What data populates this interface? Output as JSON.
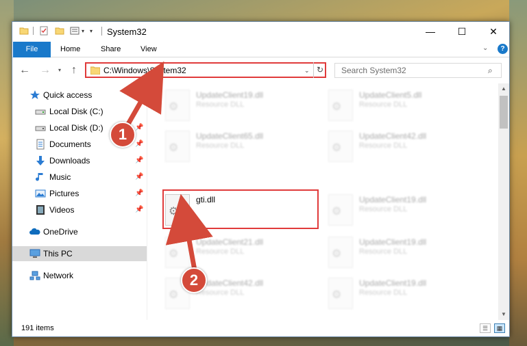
{
  "window": {
    "title": "System32",
    "controls": {
      "minimize": "—",
      "maximize": "☐",
      "close": "✕"
    }
  },
  "ribbon": {
    "tabs": [
      "File",
      "Home",
      "Share",
      "View"
    ],
    "help": "?"
  },
  "address_bar": {
    "path": "C:\\Windows\\System32",
    "search_placeholder": "Search System32"
  },
  "nav_pane": {
    "items": [
      {
        "label": "Quick access",
        "icon": "star-icon",
        "pinned": false
      },
      {
        "label": "Local Disk (C:)",
        "icon": "drive-icon",
        "pinned": false
      },
      {
        "label": "Local Disk (D:)",
        "icon": "drive-icon",
        "pinned": true
      },
      {
        "label": "Documents",
        "icon": "document-icon",
        "pinned": true
      },
      {
        "label": "Downloads",
        "icon": "download-icon",
        "pinned": true
      },
      {
        "label": "Music",
        "icon": "music-icon",
        "pinned": true
      },
      {
        "label": "Pictures",
        "icon": "pictures-icon",
        "pinned": true
      },
      {
        "label": "Videos",
        "icon": "videos-icon",
        "pinned": true
      },
      {
        "label": "OneDrive",
        "icon": "cloud-icon",
        "pinned": false
      },
      {
        "label": "This PC",
        "icon": "computer-icon",
        "pinned": false,
        "selected": true
      },
      {
        "label": "Network",
        "icon": "network-icon",
        "pinned": false
      }
    ]
  },
  "files": [
    {
      "name": "UpdateClient19.dll",
      "type": "Resource DLL",
      "blurred": true
    },
    {
      "name": "UpdateClient5.dll",
      "type": "Resource DLL",
      "blurred": true
    },
    {
      "name": "UpdateClient65.dll",
      "type": "Resource DLL",
      "blurred": true
    },
    {
      "name": "UpdateClient42.dll",
      "type": "Resource DLL",
      "blurred": true
    },
    {
      "name": "gti.dll",
      "type": "",
      "blurred": false,
      "highlighted": true
    },
    {
      "name": "UpdateClient19.dll",
      "type": "Resource DLL",
      "blurred": true
    },
    {
      "name": "UpdateClient21.dll",
      "type": "Resource DLL",
      "blurred": true
    },
    {
      "name": "UpdateClient19.dll",
      "type": "Resource DLL",
      "blurred": true
    },
    {
      "name": "UpdateClient42.dll",
      "type": "Resource DLL",
      "blurred": true
    },
    {
      "name": "UpdateClient19.dll",
      "type": "Resource DLL",
      "blurred": true
    }
  ],
  "status_bar": {
    "item_count": "191 items"
  },
  "annotations": {
    "badge_1": "1",
    "badge_2": "2",
    "color": "#d44a3a"
  }
}
